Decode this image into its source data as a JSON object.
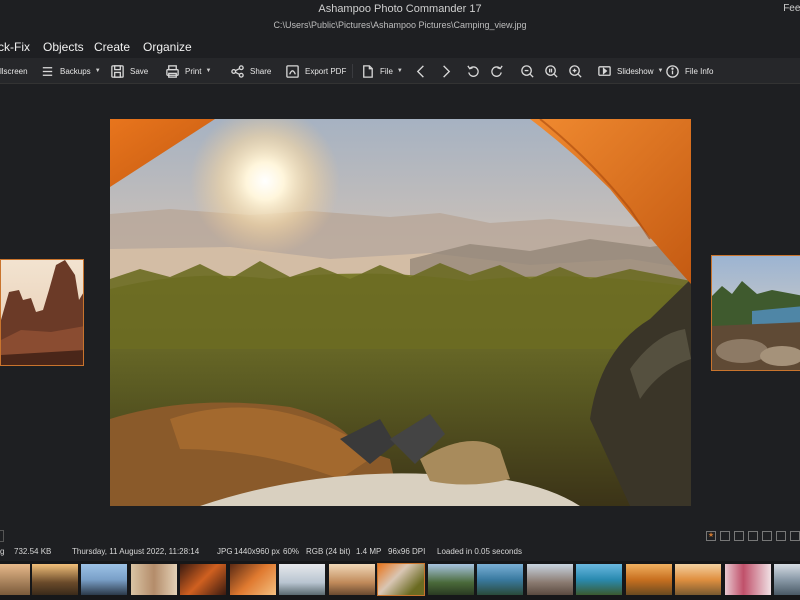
{
  "window": {
    "app_title": "Ashampoo Photo Commander 17",
    "file_path": "C:\\Users\\Public\\Pictures\\Ashampoo Pictures\\Camping_view.jpg",
    "feedback_label": "Feed"
  },
  "menu": [
    "ck-Fix",
    "Objects",
    "Create",
    "Organize"
  ],
  "toolbar": {
    "fullscreen_label": "llscreen",
    "backups_label": "Backups",
    "save_label": "Save",
    "print_label": "Print",
    "share_label": "Share",
    "export_pdf_label": "Export PDF",
    "file_label": "File",
    "slideshow_label": "Slideshow",
    "file_info_label": "File Info"
  },
  "status": {
    "partial": "g",
    "filesize": "732.54 KB",
    "date": "Thursday, 11 August 2022, 11:28:14",
    "format": "JPG",
    "dimensions": "1440x960 px",
    "zoom": "60%",
    "color_mode": "RGB (24 bit)",
    "megapixels": "1.4 MP",
    "dpi": "96x96 DPI",
    "load_time": "Loaded in 0.05 seconds"
  },
  "colors": {
    "accent": "#c9742d",
    "background": "#1e1f22",
    "toolbar": "#26272a"
  }
}
